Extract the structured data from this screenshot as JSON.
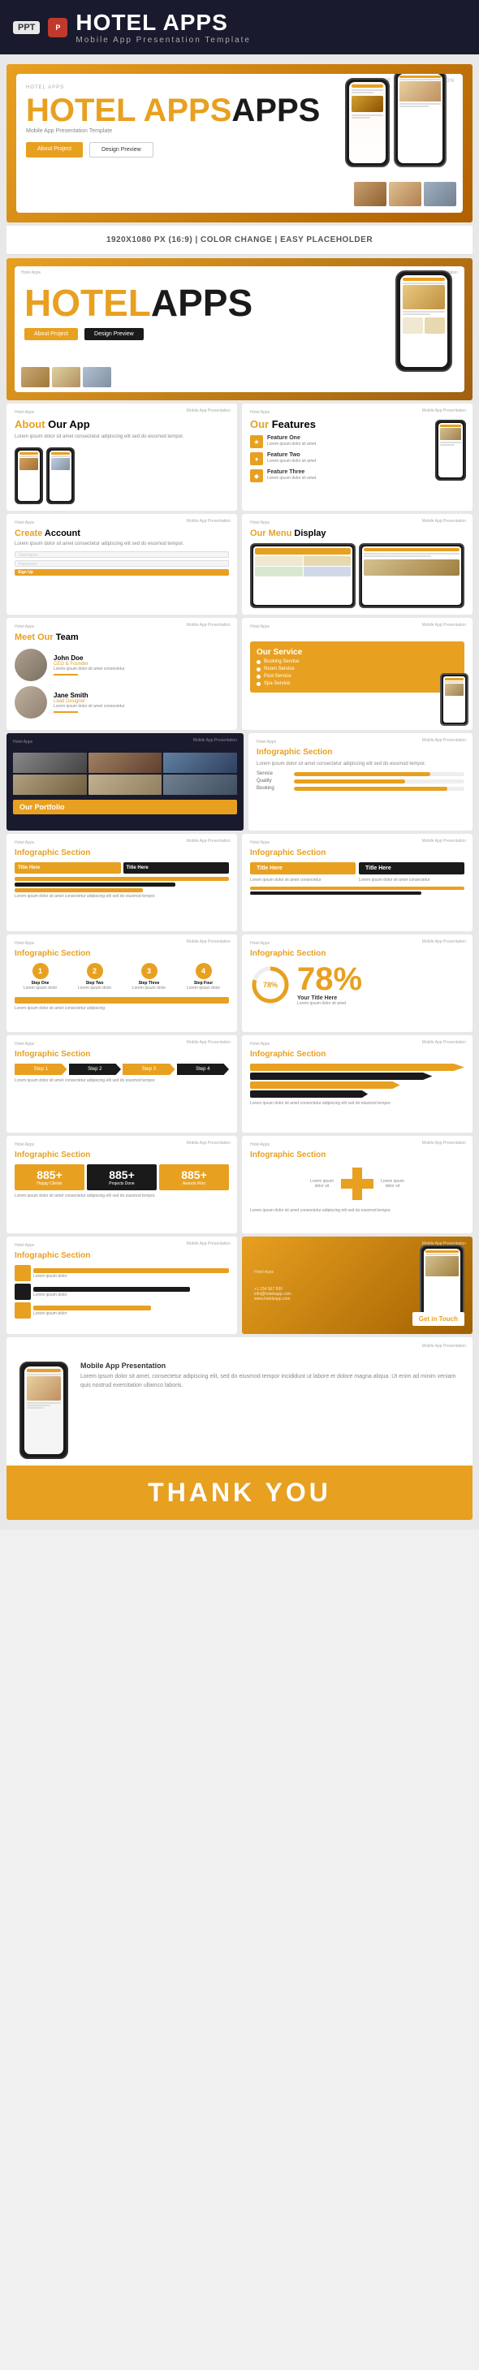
{
  "header": {
    "ppt_label": "PPT",
    "title": "HOTEL APPS",
    "subtitle": "Mobile App Presentation Template"
  },
  "info_bar": {
    "text": "1920X1080 PX (16:9) | COLOR CHANGE | EASY PLACEHOLDER"
  },
  "slides": {
    "main_title": "HOTEL APPS",
    "sub_title": "APPS",
    "about_label": "About Our App",
    "features_label": "Our Features",
    "account_label": "Create Account",
    "menu_display_label": "Our Menu Display",
    "team_label": "Meet Our Team",
    "service_label": "Our Service",
    "portfolio_label": "Our Portfolio",
    "infographic_label": "Infographic Section",
    "thankyou_label": "THANK YOU",
    "get_in_touch_label": "Get in Touch",
    "app_name": "Mobile App Presentation",
    "btn_about": "About Project",
    "btn_design": "Design Preview",
    "percent_78": "78%",
    "stat1": "885+",
    "stat2": "885+",
    "stat3": "885+",
    "title_here": "Title Here",
    "your_title": "Your Title Here",
    "lorem_short": "Lorem ipsum dolor sit amet consectetur adipiscing elit sed do eiusmod tempor.",
    "lorem_long": "Lorem ipsum dolor sit amet, consectetur adipiscing elit, sed do eiusmod tempor incididunt ut labore et dolore magna aliqua. Ut enim ad minim veniam quis nostrud exercitation ullamco laboris."
  },
  "colors": {
    "orange": "#e8a020",
    "dark": "#1a1a2e",
    "black": "#1a1a1a",
    "white": "#ffffff",
    "grey": "#888888"
  }
}
